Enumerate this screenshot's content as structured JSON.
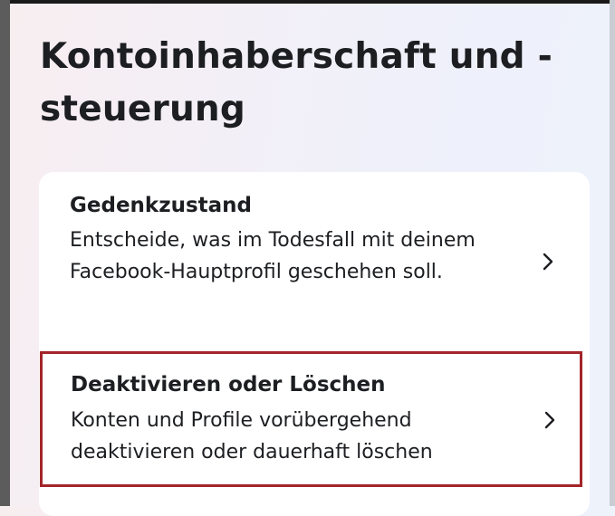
{
  "page": {
    "title": "Kontoinhaberschaft und -steuerung"
  },
  "settings": {
    "items": [
      {
        "title": "Gedenkzustand",
        "description": "Entscheide, was im Todesfall mit deinem Facebook-Hauptprofil geschehen soll.",
        "icon": "chevron-right-icon",
        "highlighted": false
      },
      {
        "title": "Deaktivieren oder Löschen",
        "description": "Konten und Profile vorübergehend deaktivieren oder dauerhaft löschen",
        "icon": "chevron-right-icon",
        "highlighted": true
      }
    ]
  },
  "colors": {
    "highlight_border": "#a3252a",
    "text": "#1c1e21",
    "card_background": "#ffffff"
  }
}
